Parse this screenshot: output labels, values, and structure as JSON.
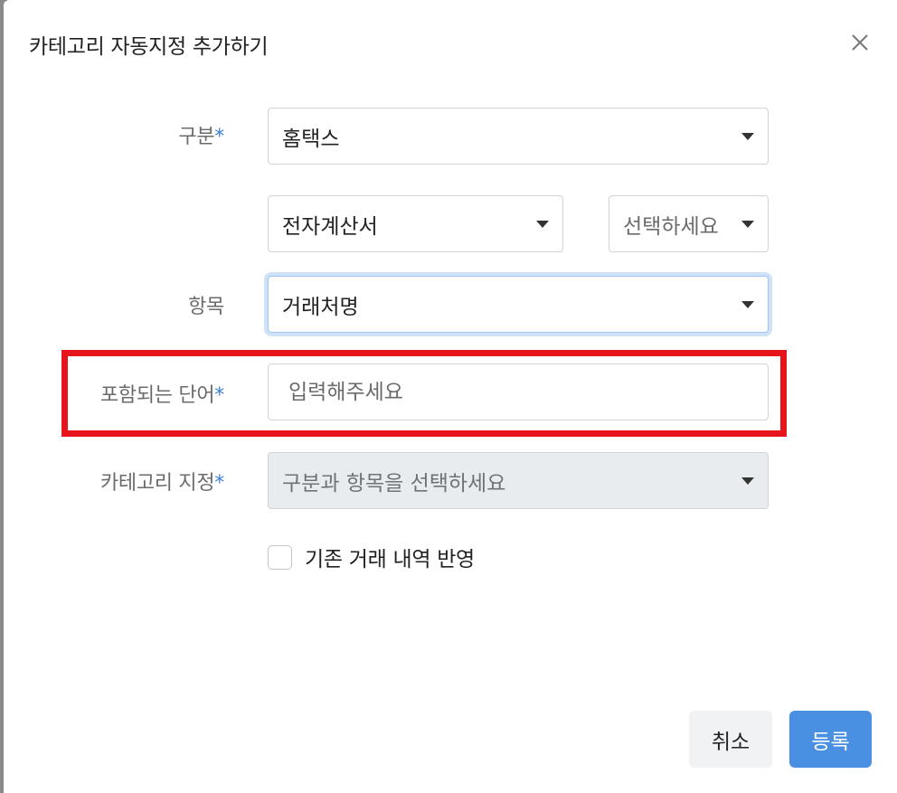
{
  "modal": {
    "title": "카테고리 자동지정 추가하기",
    "close_icon": "close-icon"
  },
  "form": {
    "division": {
      "label": "구분",
      "required_mark": "*",
      "value": "홈택스"
    },
    "doc_type": {
      "value": "전자계산서"
    },
    "sub_type": {
      "value": "선택하세요"
    },
    "item": {
      "label": "항목",
      "value": "거래처명"
    },
    "keyword": {
      "label": "포함되는 단어",
      "required_mark": "*",
      "placeholder": "입력해주세요"
    },
    "category": {
      "label": "카테고리 지정",
      "required_mark": "*",
      "value": "구분과 항목을 선택하세요"
    },
    "apply_existing": {
      "label": "기존 거래 내역 반영",
      "checked": false
    }
  },
  "buttons": {
    "cancel": "취소",
    "submit": "등록"
  },
  "colors": {
    "primary": "#4a90e2",
    "required": "#3d7fd8",
    "highlight": "#e8141b"
  }
}
